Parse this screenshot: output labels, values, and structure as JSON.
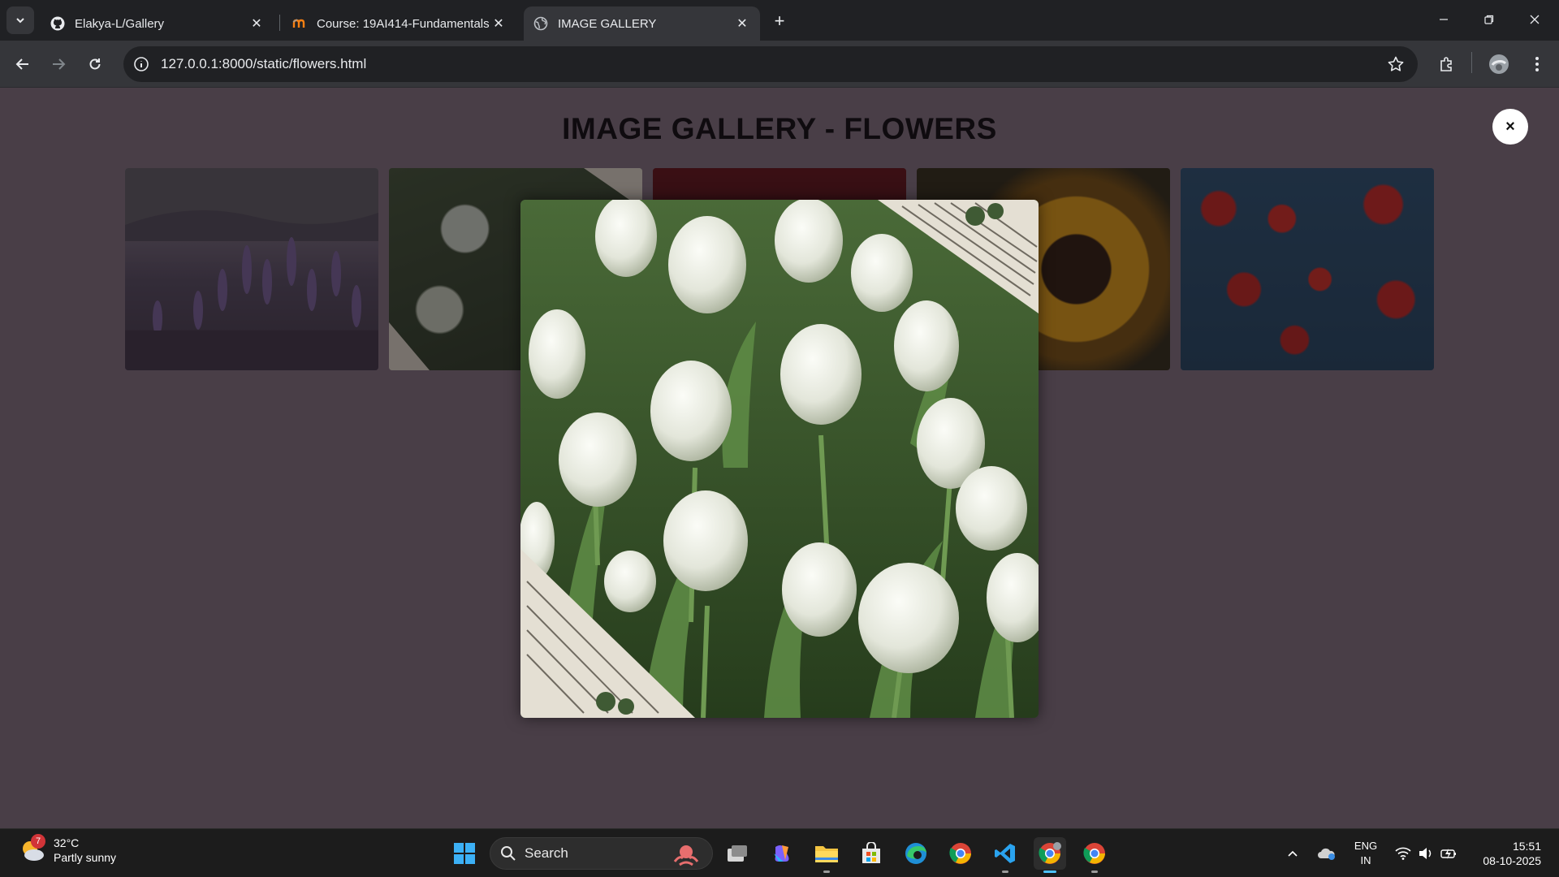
{
  "browser": {
    "tabs": [
      {
        "title": "Elakya-L/Gallery",
        "icon": "github-icon"
      },
      {
        "title": "Course: 19AI414-Fundamentals",
        "icon": "moodle-icon"
      },
      {
        "title": "IMAGE GALLERY",
        "icon": "globe-icon"
      }
    ],
    "url": "127.0.0.1:8000/static/flowers.html"
  },
  "page": {
    "title": "IMAGE GALLERY - FLOWERS",
    "close_label": "×",
    "thumbnails": [
      "lavender",
      "white-tulips",
      "red-flower",
      "sunflower",
      "poppies"
    ],
    "lightbox_image": "white-tulips"
  },
  "taskbar": {
    "weather": {
      "temp": "32°C",
      "condition": "Partly sunny",
      "badge": "7"
    },
    "search_label": "Search",
    "language": {
      "line1": "ENG",
      "line2": "IN"
    },
    "time": "15:51",
    "date": "08-10-2025"
  },
  "colors": {
    "page_bg": "#493e47",
    "title_color": "#0f0b0f",
    "chrome_bg": "#202124",
    "toolbar_bg": "#35363a"
  }
}
